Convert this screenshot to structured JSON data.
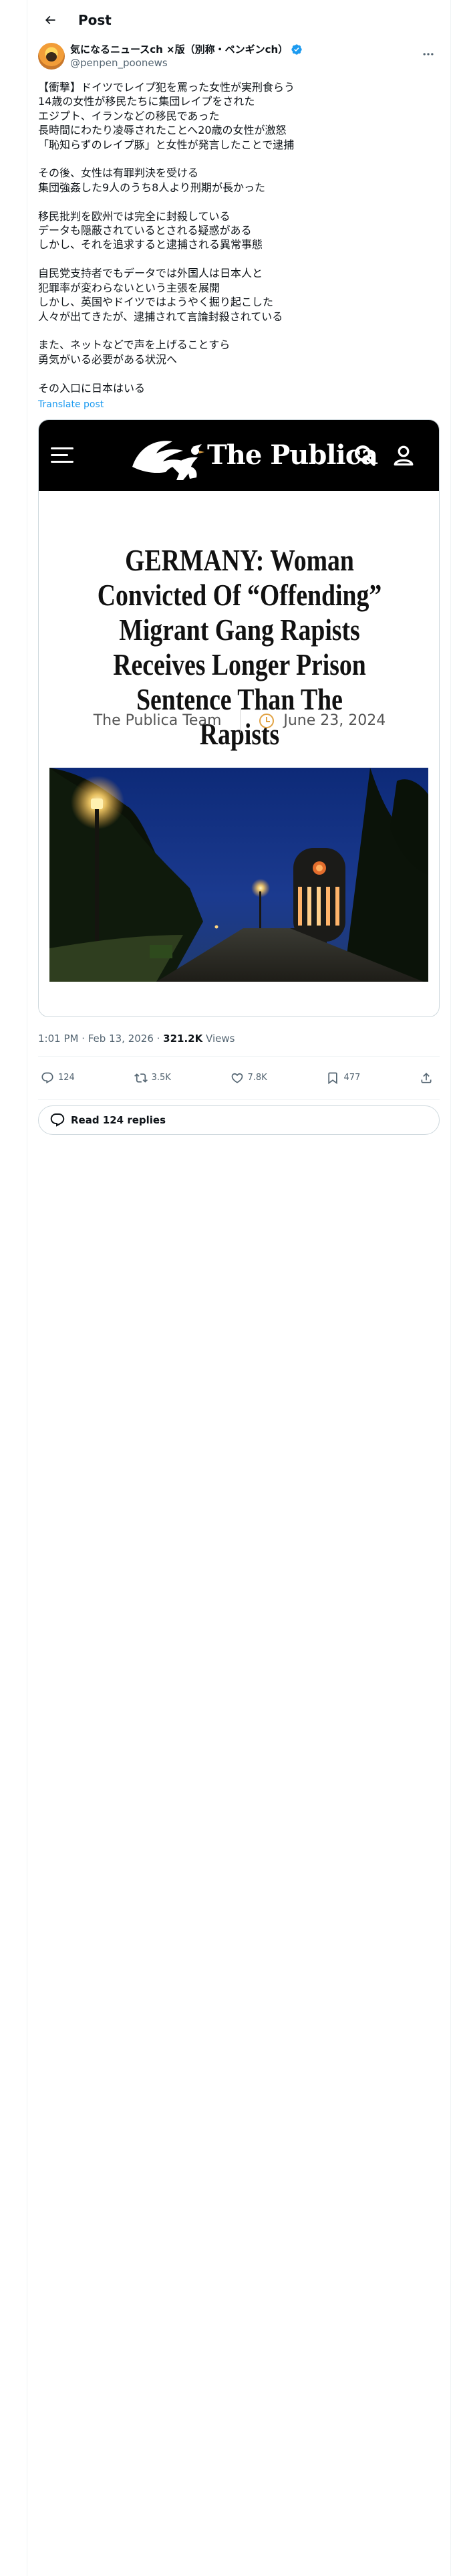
{
  "topbar": {
    "title": "Post"
  },
  "author": {
    "name": "気になるニュースch ×版（別称・ペンギンch）",
    "handle": "@penpen_poonews"
  },
  "tweet": {
    "text": "【衝撃】ドイツでレイプ犯を罵った女性が実刑食らう\n14歳の女性が移民たちに集団レイプをされた\nエジプト、イランなどの移民であった\n長時間にわたり凌辱されたことへ20歳の女性が激怒\n「恥知らずのレイプ豚」と女性が発言したことで逮捕\n\nその後、女性は有罪判決を受ける\n集団強姦した9人のうち8人より刑期が長かった\n\n移民批判を欧州では完全に封殺している\nデータも隠蔽されているとされる疑惑がある\nしかし、それを追求すると逮捕される異常事態\n\n自民党支持者でもデータでは外国人は日本人と\n犯罪率が変わらないという主張を展開\nしかし、英国やドイツではようやく掘り起こした\n人々が出てきたが、逮捕されて言論封殺されている\n\nまた、ネットなどで声を上げることすら\n勇気がいる必要がある状況へ\n\nその入口に日本はいる",
    "translate_label": "Translate post"
  },
  "card": {
    "logo_text": "The Publica",
    "headline": "GERMANY: Woman Convicted Of “Offending” Migrant Gang Rapists Receives Longer Prison Sentence Than The Rapists",
    "byline": "The Publica Team",
    "date": "June 23, 2024"
  },
  "meta": {
    "time_date": "1:01 PM · Feb 13, 2026 · ",
    "views_count": "321.2K",
    "views_label": " Views"
  },
  "actions": {
    "replies": "124",
    "reposts": "3.5K",
    "likes": "7.8K",
    "bookmarks": "477"
  },
  "read_replies_label": "Read 124 replies",
  "colors": {
    "link": "#1d9bf0",
    "verified": "#1d9bf0",
    "secondary_text": "#536471"
  }
}
